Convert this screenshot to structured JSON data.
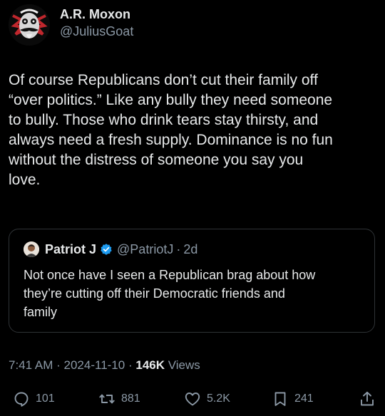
{
  "author": {
    "display_name": "A.R. Moxon",
    "handle": "@JuliusGoat"
  },
  "tweet": {
    "text": "Of course Republicans don’t cut their family off\n“over politics.” Like any bully they need someone\nto bully. Those who drink tears stay thirsty, and\nalways need a fresh supply. Dominance is no fun\nwithout the distress of someone you say you\nlove."
  },
  "quoted_tweet": {
    "display_name": "Patriot J",
    "handle": "@PatriotJ",
    "separator": "·",
    "time": "2d",
    "text": "Not once have I seen a Republican brag about how\nthey’re cutting off their Democratic friends and\nfamily"
  },
  "meta": {
    "time": "7:41 AM",
    "sep1": "·",
    "date": "2024-11-10",
    "sep2": "·",
    "views_count": "146K",
    "views_label": "Views"
  },
  "actions": {
    "replies": "101",
    "reposts": "881",
    "likes": "5.2K",
    "bookmarks": "241"
  },
  "icons": {
    "reply": "reply-icon",
    "repost": "repost-icon",
    "like": "heart-icon",
    "bookmark": "bookmark-icon",
    "share": "share-icon",
    "verified": "verified-badge-icon"
  },
  "colors": {
    "background": "#000000",
    "text_primary": "#e7e9ea",
    "text_secondary": "#8b98a5",
    "border": "#2f3336",
    "verified_blue": "#1d9bf0"
  }
}
